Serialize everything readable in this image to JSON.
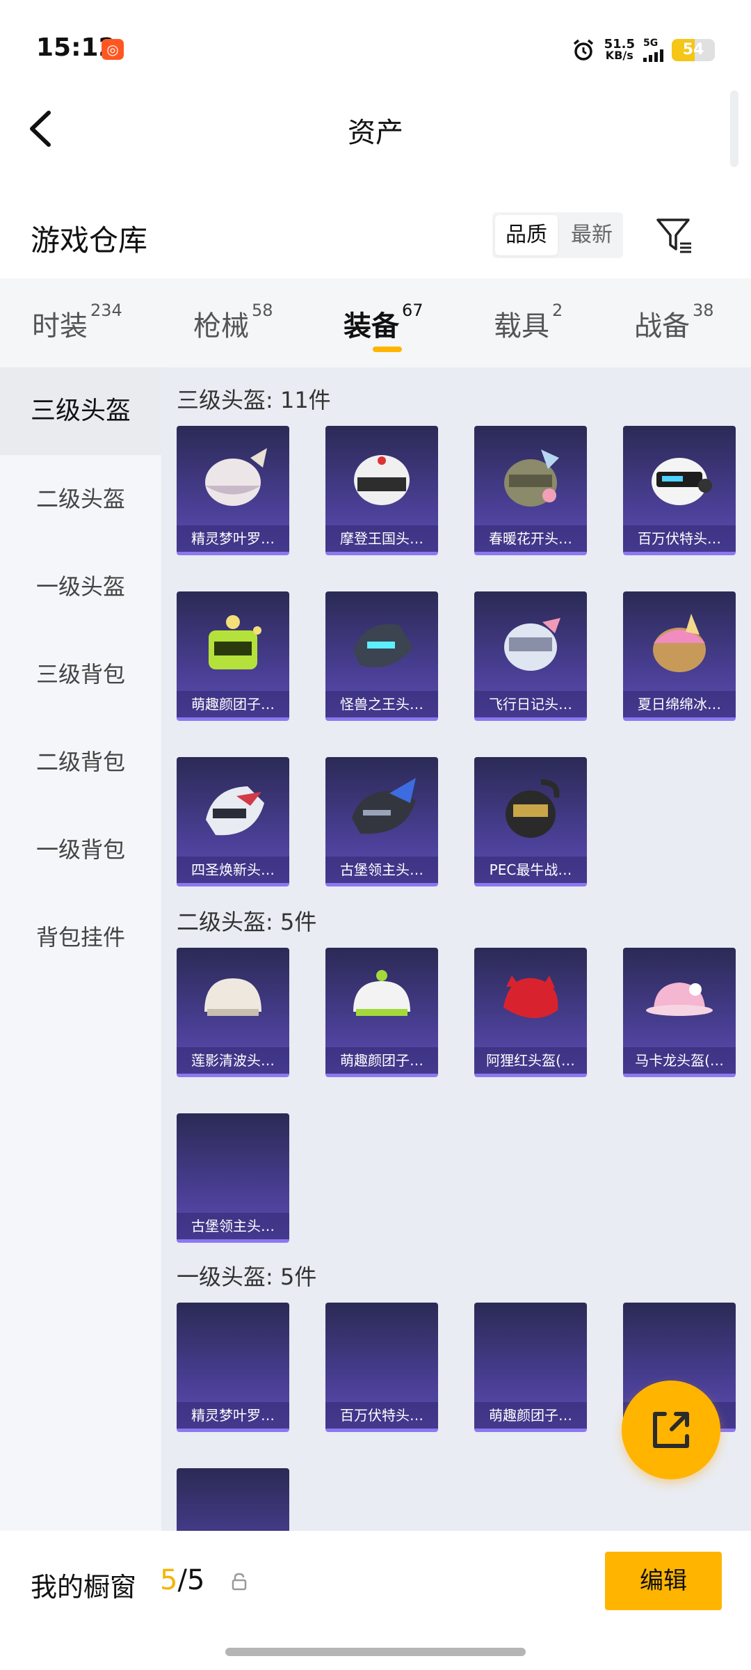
{
  "status_bar": {
    "time": "15:12",
    "net_speed_value": "51.5",
    "net_speed_unit": "KB/s",
    "network": "5G",
    "battery_level": "54",
    "colors": {
      "battery": "#f5c518",
      "app_icon": "#ff5722"
    },
    "icons": [
      "app-notification-icon",
      "alarm-icon",
      "signal-icon",
      "battery-icon"
    ]
  },
  "header": {
    "title": "资产",
    "back_icon": "chevron-left-icon"
  },
  "warehouse": {
    "title": "游戏仓库",
    "sort_options": [
      "品质",
      "最新"
    ],
    "selected_sort": "品质",
    "filter_icon": "filter-icon"
  },
  "tabs": [
    {
      "label": "时装",
      "count": "234"
    },
    {
      "label": "枪械",
      "count": "58"
    },
    {
      "label": "装备",
      "count": "67"
    },
    {
      "label": "载具",
      "count": "2"
    },
    {
      "label": "战备",
      "count": "38"
    }
  ],
  "active_tab": "装备",
  "sidebar": {
    "items": [
      "三级头盔",
      "二级头盔",
      "一级头盔",
      "三级背包",
      "二级背包",
      "一级背包",
      "背包挂件"
    ],
    "active": "三级头盔"
  },
  "sections": [
    {
      "title": "三级头盔: 11件",
      "items": [
        "精灵梦叶罗…",
        "摩登王国头…",
        "春暖花开头…",
        "百万伏特头…",
        "萌趣颜团子…",
        "怪兽之王头…",
        "飞行日记头…",
        "夏日绵绵冰…",
        "四圣焕新头…",
        "古堡领主头…",
        "PEC最牛战…"
      ]
    },
    {
      "title": "二级头盔: 5件",
      "items": [
        "莲影清波头…",
        "萌趣颜团子…",
        "阿狸红头盔(…",
        "马卡龙头盔(…",
        "古堡领主头…"
      ]
    },
    {
      "title": "一级头盔: 5件",
      "items": [
        "精灵梦叶罗…",
        "百万伏特头…",
        "萌趣颜团子…",
        "…",
        ""
      ]
    }
  ],
  "share_button_icon": "share-external-icon",
  "bottom_bar": {
    "showcase_label": "我的橱窗",
    "showcase_current": "5",
    "showcase_separator": "/",
    "showcase_max": "5",
    "lock_icon": "lock-icon",
    "edit_label": "编辑"
  },
  "colors": {
    "accent": "#ffb400",
    "card_top": "#2b2a55",
    "card_bottom": "#5b4fb0"
  }
}
